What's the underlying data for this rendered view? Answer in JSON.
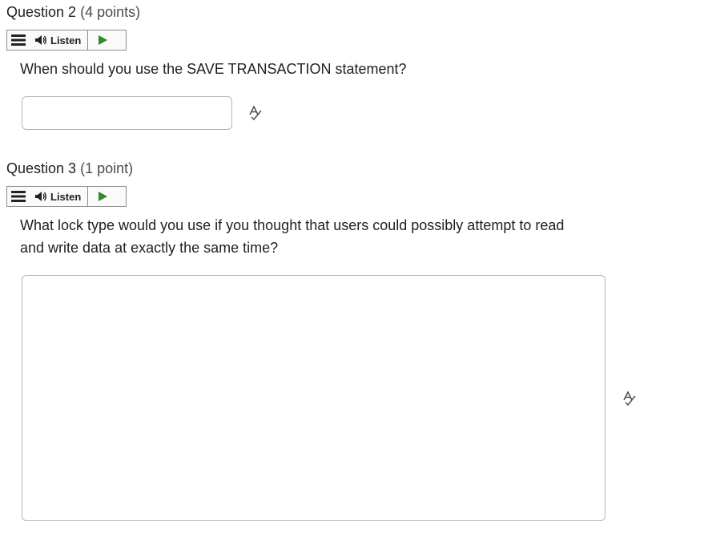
{
  "question2": {
    "name": "Question 2",
    "points": "(4 points)",
    "listen_label": "Listen",
    "text": "When should you use the SAVE TRANSACTION statement?",
    "answer_value": ""
  },
  "question3": {
    "name": "Question 3",
    "points": "(1 point)",
    "listen_label": "Listen",
    "text": "What lock type would you use if you thought that users could possibly attempt to read and write data at exactly the same time?",
    "answer_value": ""
  },
  "icons": {
    "menu": "hamburger-menu-icon",
    "speaker": "speaker-icon",
    "play": "play-icon",
    "spellcheck": "spellcheck-icon"
  },
  "colors": {
    "play_green": "#2e8b2e",
    "text": "#202122",
    "border": "#b5b5b5"
  }
}
